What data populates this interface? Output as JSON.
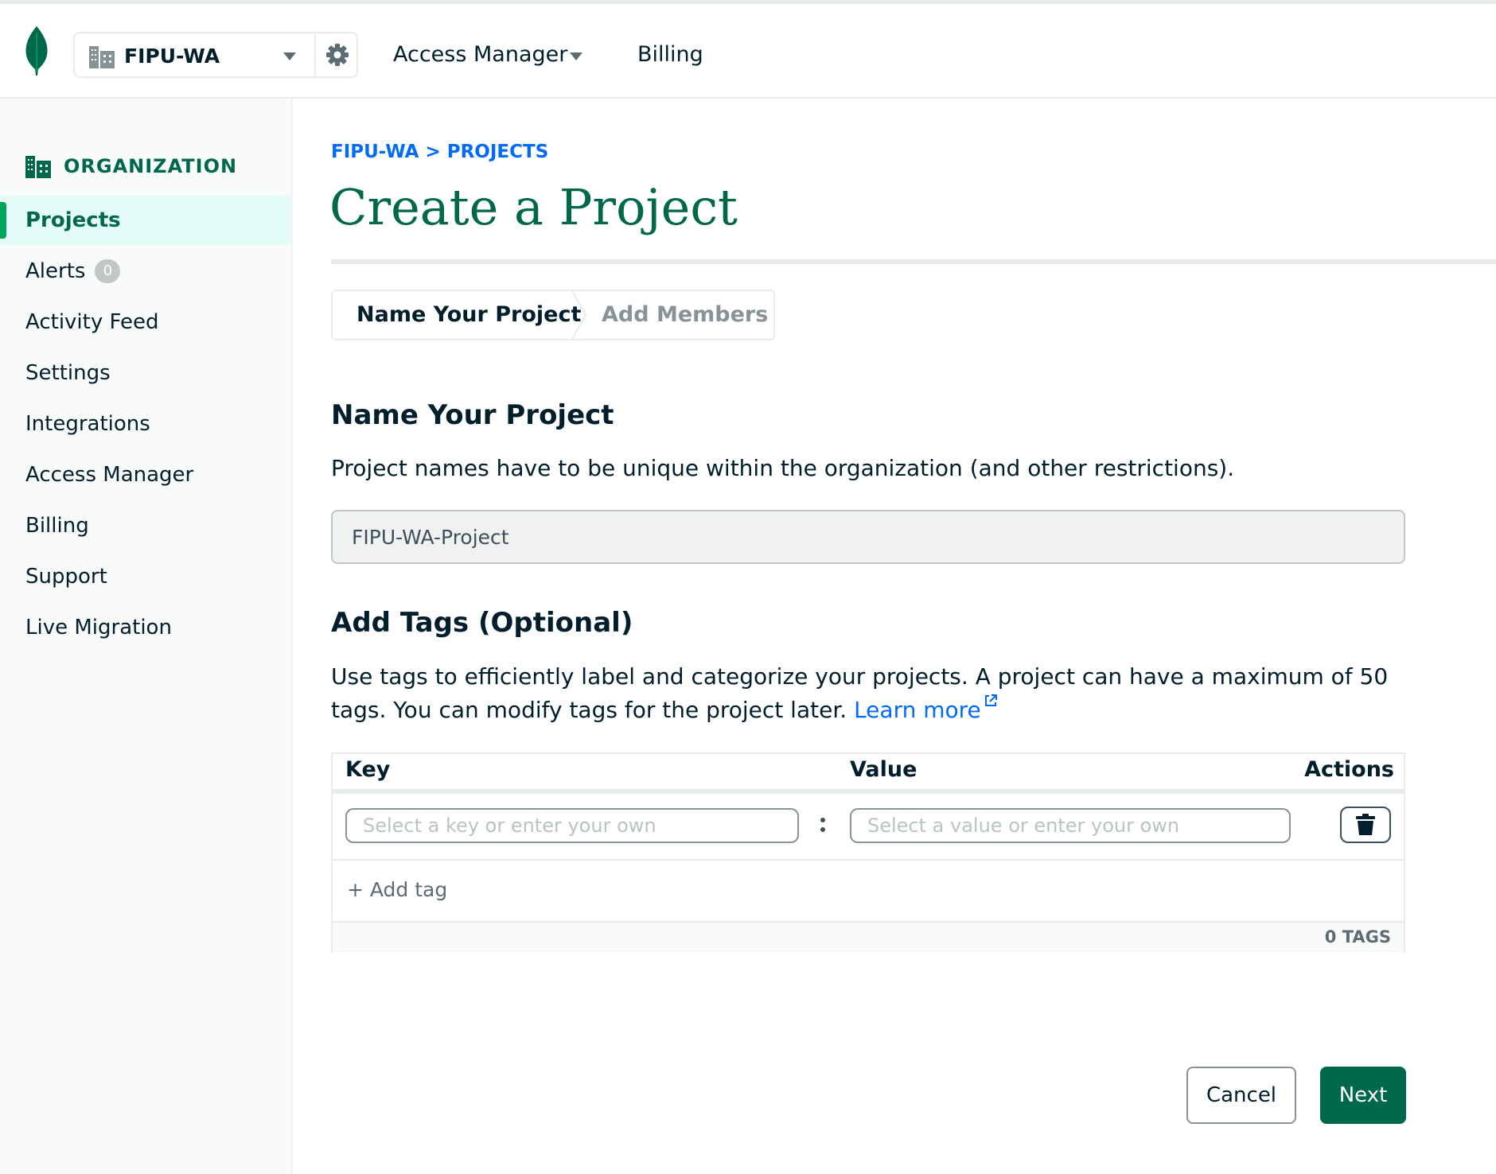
{
  "topbar": {
    "org_name": "FIPU-WA",
    "nav": [
      {
        "label": "Access Manager"
      },
      {
        "label": "Billing"
      }
    ]
  },
  "sidebar": {
    "heading": "ORGANIZATION",
    "items": [
      {
        "label": "Projects",
        "active": true
      },
      {
        "label": "Alerts",
        "badge": "0"
      },
      {
        "label": "Activity Feed"
      },
      {
        "label": "Settings"
      },
      {
        "label": "Integrations"
      },
      {
        "label": "Access Manager"
      },
      {
        "label": "Billing"
      },
      {
        "label": "Support"
      },
      {
        "label": "Live Migration"
      }
    ]
  },
  "main": {
    "breadcrumb": "FIPU-WA > PROJECTS",
    "title": "Create a Project",
    "steps": [
      "Name Your Project",
      "Add Members"
    ],
    "name_section": {
      "heading": "Name Your Project",
      "description": "Project names have to be unique within the organization (and other restrictions).",
      "input_value": "FIPU-WA-Project"
    },
    "tags_section": {
      "heading": "Add Tags (Optional)",
      "description": "Use tags to efficiently label and categorize your projects. A project can have a maximum of 50 tags. You can modify tags for the project later.",
      "learn_more": "Learn more",
      "columns": {
        "key": "Key",
        "value": "Value",
        "actions": "Actions"
      },
      "key_placeholder": "Select a key or enter your own",
      "value_placeholder": "Select a value or enter your own",
      "add_tag": "+ Add tag",
      "count": "0 TAGS"
    },
    "buttons": {
      "cancel": "Cancel",
      "next": "Next"
    }
  },
  "colors": {
    "brand_green": "#00684a",
    "link_blue": "#016bf8",
    "active_bg": "#e3fcf7"
  }
}
